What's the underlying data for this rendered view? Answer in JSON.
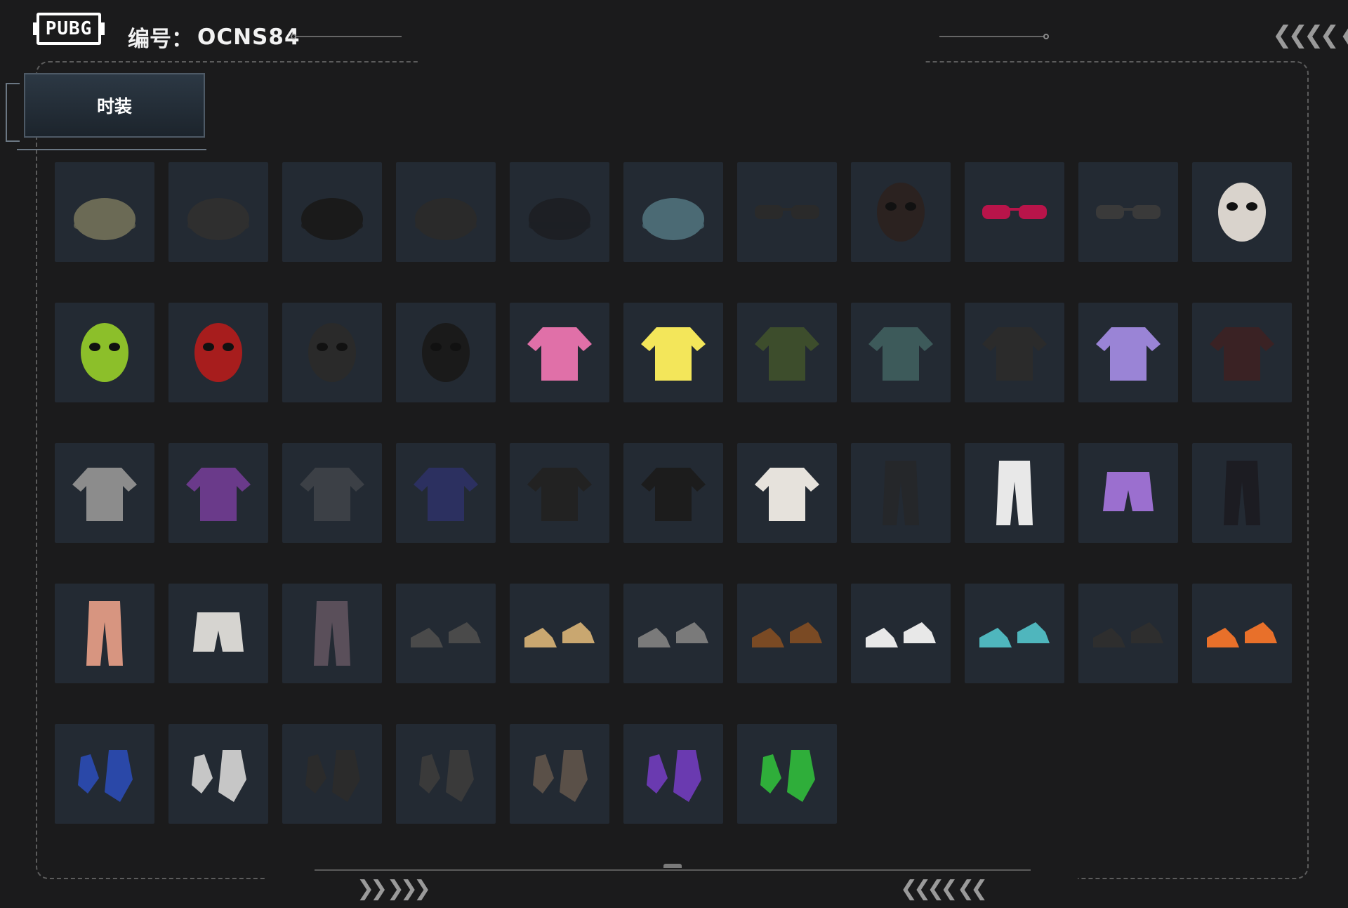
{
  "header": {
    "logo_text": "PUBG",
    "serial_label": "编号：",
    "serial_code": "OCNS84"
  },
  "tabs": [
    {
      "label": "时装",
      "selected": true
    }
  ],
  "colors": {
    "background": "#1b1b1c",
    "cell": "#232a33",
    "frame": "#5c5c5c",
    "tab_active": "#2c3844"
  },
  "items": [
    {
      "icon": "headset-cap-icon",
      "color": "#6b6a55"
    },
    {
      "icon": "black-cap-icon",
      "color": "#2f2f2f"
    },
    {
      "icon": "cat-beanie-icon",
      "color": "#1a1a1a"
    },
    {
      "icon": "beanie-icon",
      "color": "#2a2a2a"
    },
    {
      "icon": "dark-cap-icon",
      "color": "#1d1f24"
    },
    {
      "icon": "bucket-hat-icon",
      "color": "#4b6a74"
    },
    {
      "icon": "tactical-glasses-icon",
      "color": "#2a2a2a"
    },
    {
      "icon": "cat-mask-icon",
      "color": "#2b2220"
    },
    {
      "icon": "red-sunglasses-icon",
      "color": "#b8144a"
    },
    {
      "icon": "black-sunglasses-icon",
      "color": "#3a3a3a"
    },
    {
      "icon": "clown-mask-icon",
      "color": "#d9d3cc"
    },
    {
      "icon": "alien-mask-icon",
      "color": "#8cbf2a"
    },
    {
      "icon": "red-demon-mask-icon",
      "color": "#a71d1d"
    },
    {
      "icon": "tactical-mask-icon",
      "color": "#2a2a2a"
    },
    {
      "icon": "teeth-face-mask-icon",
      "color": "#1a1a1a"
    },
    {
      "icon": "pink-jacket-icon",
      "color": "#e070a8"
    },
    {
      "icon": "yellow-tshirt-icon",
      "color": "#f3e65a"
    },
    {
      "icon": "green-sweater-icon",
      "color": "#3d4d2c"
    },
    {
      "icon": "floral-shirt-icon",
      "color": "#3d5a5a"
    },
    {
      "icon": "black-jacket-icon",
      "color": "#2b2b2b"
    },
    {
      "icon": "purple-hoodie-icon",
      "color": "#9a84d6"
    },
    {
      "icon": "red-black-hoodie-icon",
      "color": "#3a2224"
    },
    {
      "icon": "silver-jacket-icon",
      "color": "#8c8c8c"
    },
    {
      "icon": "purple-bomber-icon",
      "color": "#6a3a8a"
    },
    {
      "icon": "hooded-coat-icon",
      "color": "#3c4046"
    },
    {
      "icon": "navy-sweatshirt-icon",
      "color": "#2c3060"
    },
    {
      "icon": "leather-jacket-icon",
      "color": "#222222"
    },
    {
      "icon": "black-hoodie-icon",
      "color": "#1c1c1c"
    },
    {
      "icon": "orange-white-jacket-icon",
      "color": "#e6e2dc"
    },
    {
      "icon": "black-pants-icon",
      "color": "#25272a"
    },
    {
      "icon": "white-pants-icon",
      "color": "#e8e8e8"
    },
    {
      "icon": "purple-shorts-icon",
      "color": "#9b6fcf"
    },
    {
      "icon": "black-purple-pants-icon",
      "color": "#1c1c22"
    },
    {
      "icon": "pink-pants-icon",
      "color": "#d79580"
    },
    {
      "icon": "white-shorts-icon",
      "color": "#d6d4d0"
    },
    {
      "icon": "camo-pants-icon",
      "color": "#5a4f5a"
    },
    {
      "icon": "bunny-shoes-icon",
      "color": "#4a4a4a"
    },
    {
      "icon": "tan-boots-icon",
      "color": "#c9a770"
    },
    {
      "icon": "grey-orange-sneakers-icon",
      "color": "#7a7a7a"
    },
    {
      "icon": "paw-slippers-icon",
      "color": "#7a4a24"
    },
    {
      "icon": "white-sneakers-icon",
      "color": "#e8e8e8"
    },
    {
      "icon": "teal-clogs-icon",
      "color": "#4fb6bd"
    },
    {
      "icon": "fur-boots-icon",
      "color": "#2e2e2e"
    },
    {
      "icon": "orange-sneakers-icon",
      "color": "#e8702a"
    },
    {
      "icon": "blue-white-gloves-icon",
      "color": "#2a48a8"
    },
    {
      "icon": "white-hand-gloves-icon",
      "color": "#c6c6c6"
    },
    {
      "icon": "fingerless-gloves-icon",
      "color": "#2b2b2b"
    },
    {
      "icon": "wrap-gloves-icon",
      "color": "#3a3a3a"
    },
    {
      "icon": "tactical-gloves-icon",
      "color": "#5a5048"
    },
    {
      "icon": "purple-gloves-icon",
      "color": "#6a3ab0"
    },
    {
      "icon": "green-gloves-icon",
      "color": "#2fae3a"
    }
  ]
}
